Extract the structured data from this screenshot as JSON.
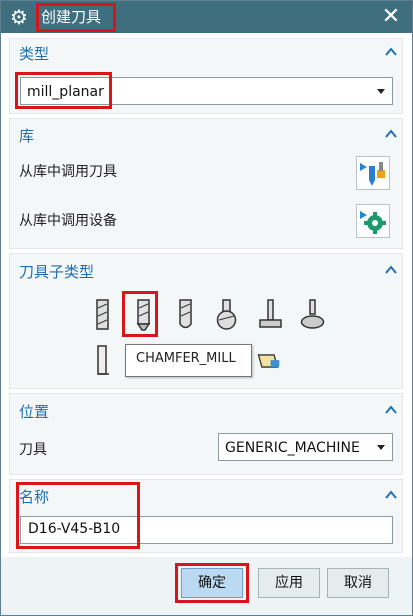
{
  "window": {
    "title": "创建刀具",
    "settings_icon": "gear-icon",
    "close_icon": "close-icon"
  },
  "type_section": {
    "title": "类型",
    "selected": "mill_planar"
  },
  "library_section": {
    "title": "库",
    "items": [
      {
        "label": "从库中调用刀具",
        "icon": "retrieve-tool-from-library-icon"
      },
      {
        "label": "从库中调用设备",
        "icon": "retrieve-device-from-library-icon"
      }
    ]
  },
  "subtype_section": {
    "title": "刀具子类型",
    "tools": [
      "mill-icon",
      "chamfer-mill-icon",
      "ball-mill-icon",
      "spherical-mill-icon",
      "t-cutter-icon",
      "barrel-cutter-icon",
      "thread-mill-icon",
      "mill-form-icon"
    ],
    "tooltip": "CHAMFER_MILL"
  },
  "location_section": {
    "title": "位置",
    "tool_label": "刀具",
    "tool_value": "GENERIC_MACHINE"
  },
  "name_section": {
    "title": "名称",
    "value": "D16-V45-B10"
  },
  "buttons": {
    "ok": "确定",
    "apply": "应用",
    "cancel": "取消"
  },
  "colors": {
    "title_bar": "#3f6f7f",
    "section_title": "#1f6fb0",
    "highlight": "#d9141b"
  }
}
